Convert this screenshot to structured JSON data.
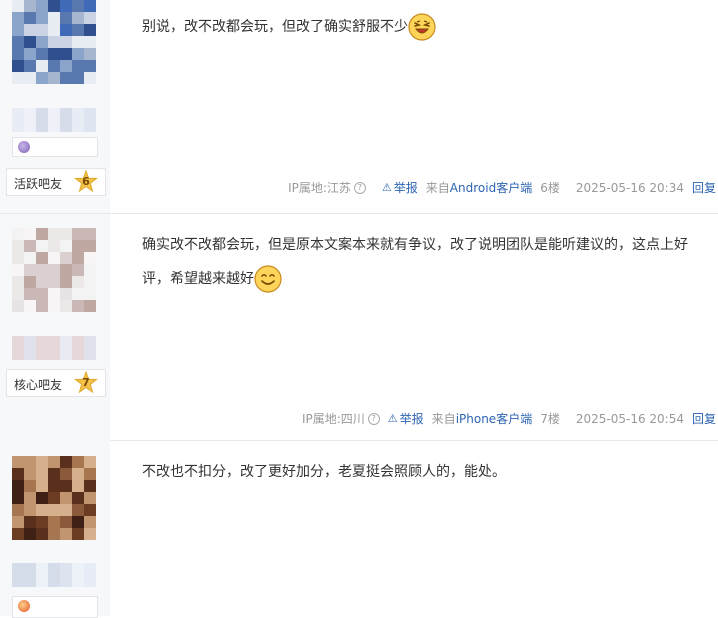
{
  "posts": [
    {
      "level_name": "活跃吧友",
      "level_num": "6",
      "content_line1": "别说，改不改都会玩，但改了确实舒服不少",
      "content_line2": "",
      "emoji_name": "laughing-emoji",
      "ip_label": "IP属地:江苏",
      "report_label": "举报",
      "client_prefix": "来自",
      "client_name": "Android客户端",
      "floor": "6楼",
      "time": "2025-05-16 20:34",
      "reply_label": "回复"
    },
    {
      "level_name": "核心吧友",
      "level_num": "7",
      "content_line1": "确实改不改都会玩，但是原本文案本来就有争议，改了说明团队是能听建议的，这点上好",
      "content_line2": "评，希望越来越好",
      "emoji_name": "smiling-emoji",
      "ip_label": "IP属地:四川",
      "report_label": "举报",
      "client_prefix": "来自",
      "client_name": "iPhone客户端",
      "floor": "7楼",
      "time": "2025-05-16 20:54",
      "reply_label": "回复"
    },
    {
      "content_line1": "不改也不扣分，改了更好加分，老夏挺会照顾人的，能处。"
    }
  ],
  "colors": {
    "link": "#2d64b3",
    "meta_text": "#999999",
    "sidebar_bg": "#f7f8fa",
    "level_star": "#f3c24a"
  }
}
